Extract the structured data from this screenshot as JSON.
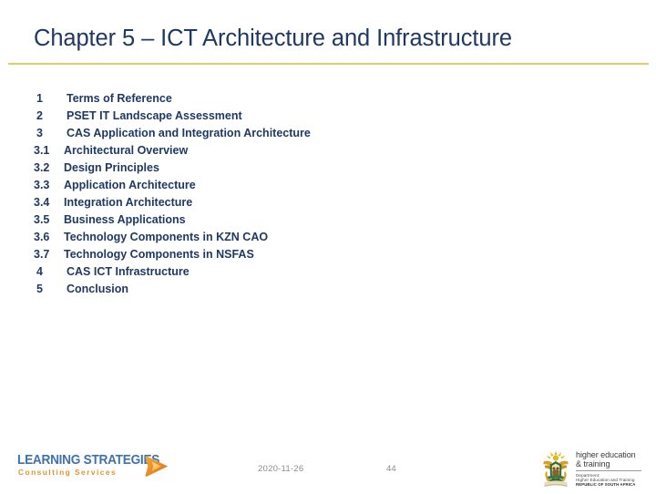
{
  "slide": {
    "title": "Chapter 5 – ICT Architecture and Infrastructure",
    "accent_gold": "#E3CC63",
    "title_color": "#1F3864"
  },
  "agenda": {
    "items": [
      {
        "number": "1",
        "label": "Terms of Reference"
      },
      {
        "number": "2",
        "label": "PSET IT Landscape Assessment"
      },
      {
        "number": "3",
        "label": "CAS Application and Integration Architecture"
      },
      {
        "number": "3.1",
        "label": "Architectural Overview"
      },
      {
        "number": "3.2",
        "label": "Design Principles"
      },
      {
        "number": "3.3",
        "label": "Application Architecture"
      },
      {
        "number": "3.4",
        "label": "Integration Architecture"
      },
      {
        "number": "3.5",
        "label": "Business Applications"
      },
      {
        "number": "3.6",
        "label": "Technology Components in KZN CAO"
      },
      {
        "number": "3.7",
        "label": "Technology Components in NSFAS"
      },
      {
        "number": "4",
        "label": "CAS ICT Infrastructure"
      },
      {
        "number": "5",
        "label": "Conclusion"
      }
    ]
  },
  "footer": {
    "date": "2020-11-26",
    "page_number": "44",
    "brand_logo": {
      "name": "LEARNING STRATEGIES",
      "tagline": "Consulting Services",
      "mark_icon": "play-triangle-icon",
      "name_color": "#3E72AE",
      "tagline_color": "#E8922B"
    },
    "gov_logo": {
      "crest_icon": "south-africa-coat-of-arms-icon",
      "title_line1": "higher education",
      "title_line2": "& training",
      "dept_line1": "Department:",
      "dept_line2": "Higher Education and Training",
      "dept_line3": "REPUBLIC OF SOUTH AFRICA"
    }
  }
}
